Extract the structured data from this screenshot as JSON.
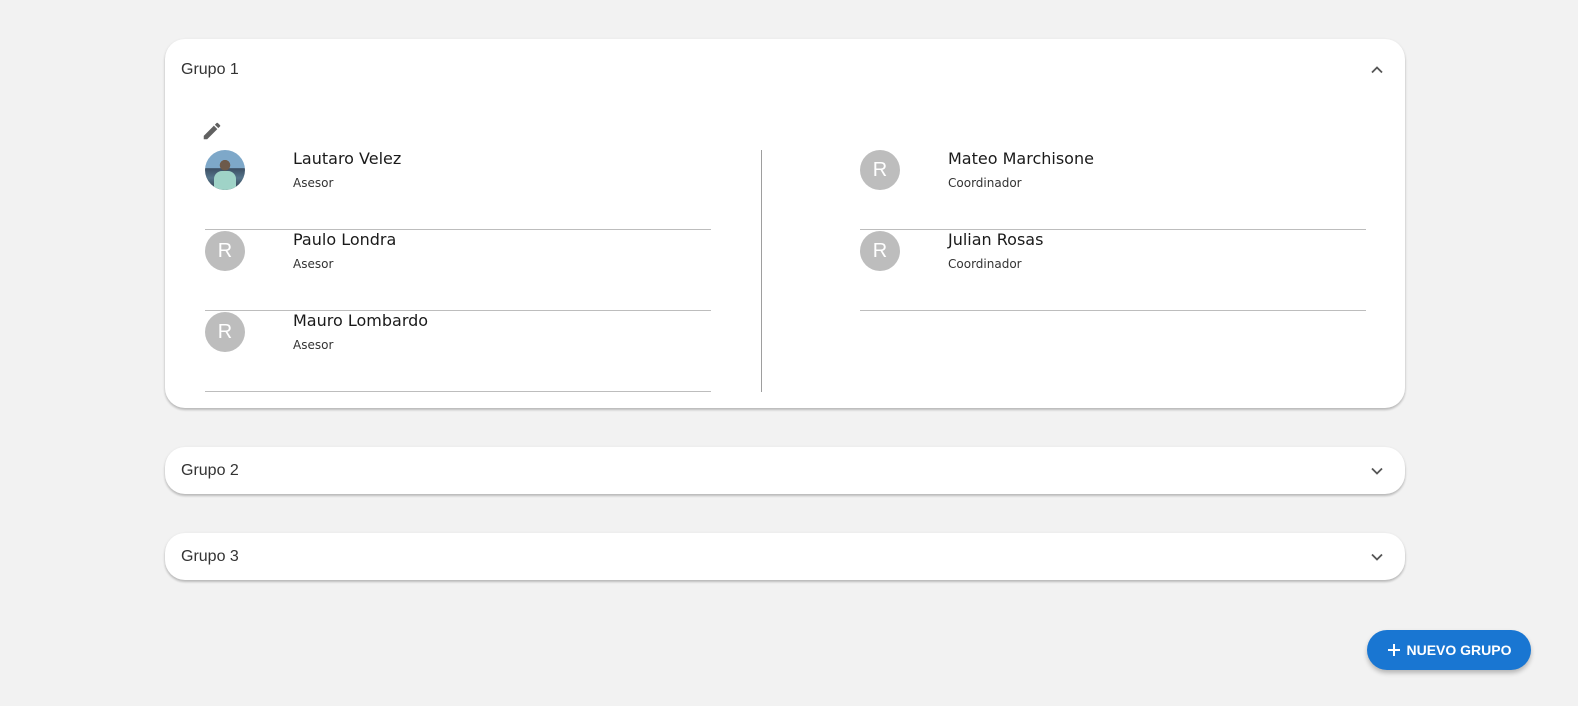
{
  "groups": [
    {
      "title": "Grupo 1",
      "expanded": true,
      "left_members": [
        {
          "name": "Lautaro Velez",
          "role": "Asesor",
          "avatar": "photo"
        },
        {
          "name": "Paulo Londra",
          "role": "Asesor",
          "avatar": "R"
        },
        {
          "name": "Mauro Lombardo",
          "role": "Asesor",
          "avatar": "R"
        }
      ],
      "right_members": [
        {
          "name": "Mateo Marchisone",
          "role": "Coordinador",
          "avatar": "R"
        },
        {
          "name": "Julian Rosas",
          "role": "Coordinador",
          "avatar": "R"
        }
      ]
    },
    {
      "title": "Grupo 2",
      "expanded": false
    },
    {
      "title": "Grupo 3",
      "expanded": false
    }
  ],
  "icons": {
    "edit": "pencil-icon",
    "expand": "chevron-down-icon",
    "collapse": "chevron-up-icon",
    "add": "plus-icon"
  },
  "fab": {
    "label": "NUEVO GRUPO"
  },
  "colors": {
    "accent": "#1976d2",
    "avatar_bg": "#bdbdbd",
    "background": "#f2f2f2"
  }
}
